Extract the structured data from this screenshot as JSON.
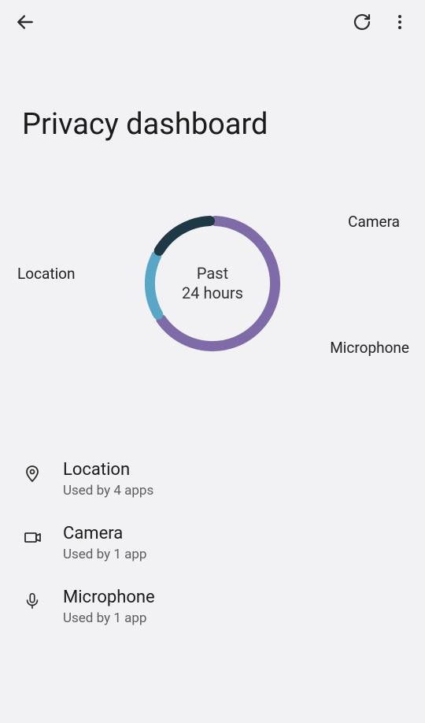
{
  "title": "Privacy dashboard",
  "chart_data": {
    "type": "pie",
    "title": "Past\n24 hours",
    "series": [
      {
        "name": "Location",
        "value": 66,
        "color": "#7e6ba8"
      },
      {
        "name": "Camera",
        "value": 17,
        "color": "#5aa6c7"
      },
      {
        "name": "Microphone",
        "value": 17,
        "color": "#1f3845"
      }
    ]
  },
  "labels": {
    "location": "Location",
    "camera": "Camera",
    "microphone": "Microphone"
  },
  "list": {
    "items": [
      {
        "title": "Location",
        "subtitle": "Used by 4 apps",
        "icon": "location"
      },
      {
        "title": "Camera",
        "subtitle": "Used by 1 app",
        "icon": "camera"
      },
      {
        "title": "Microphone",
        "subtitle": "Used by 1 app",
        "icon": "microphone"
      }
    ]
  }
}
